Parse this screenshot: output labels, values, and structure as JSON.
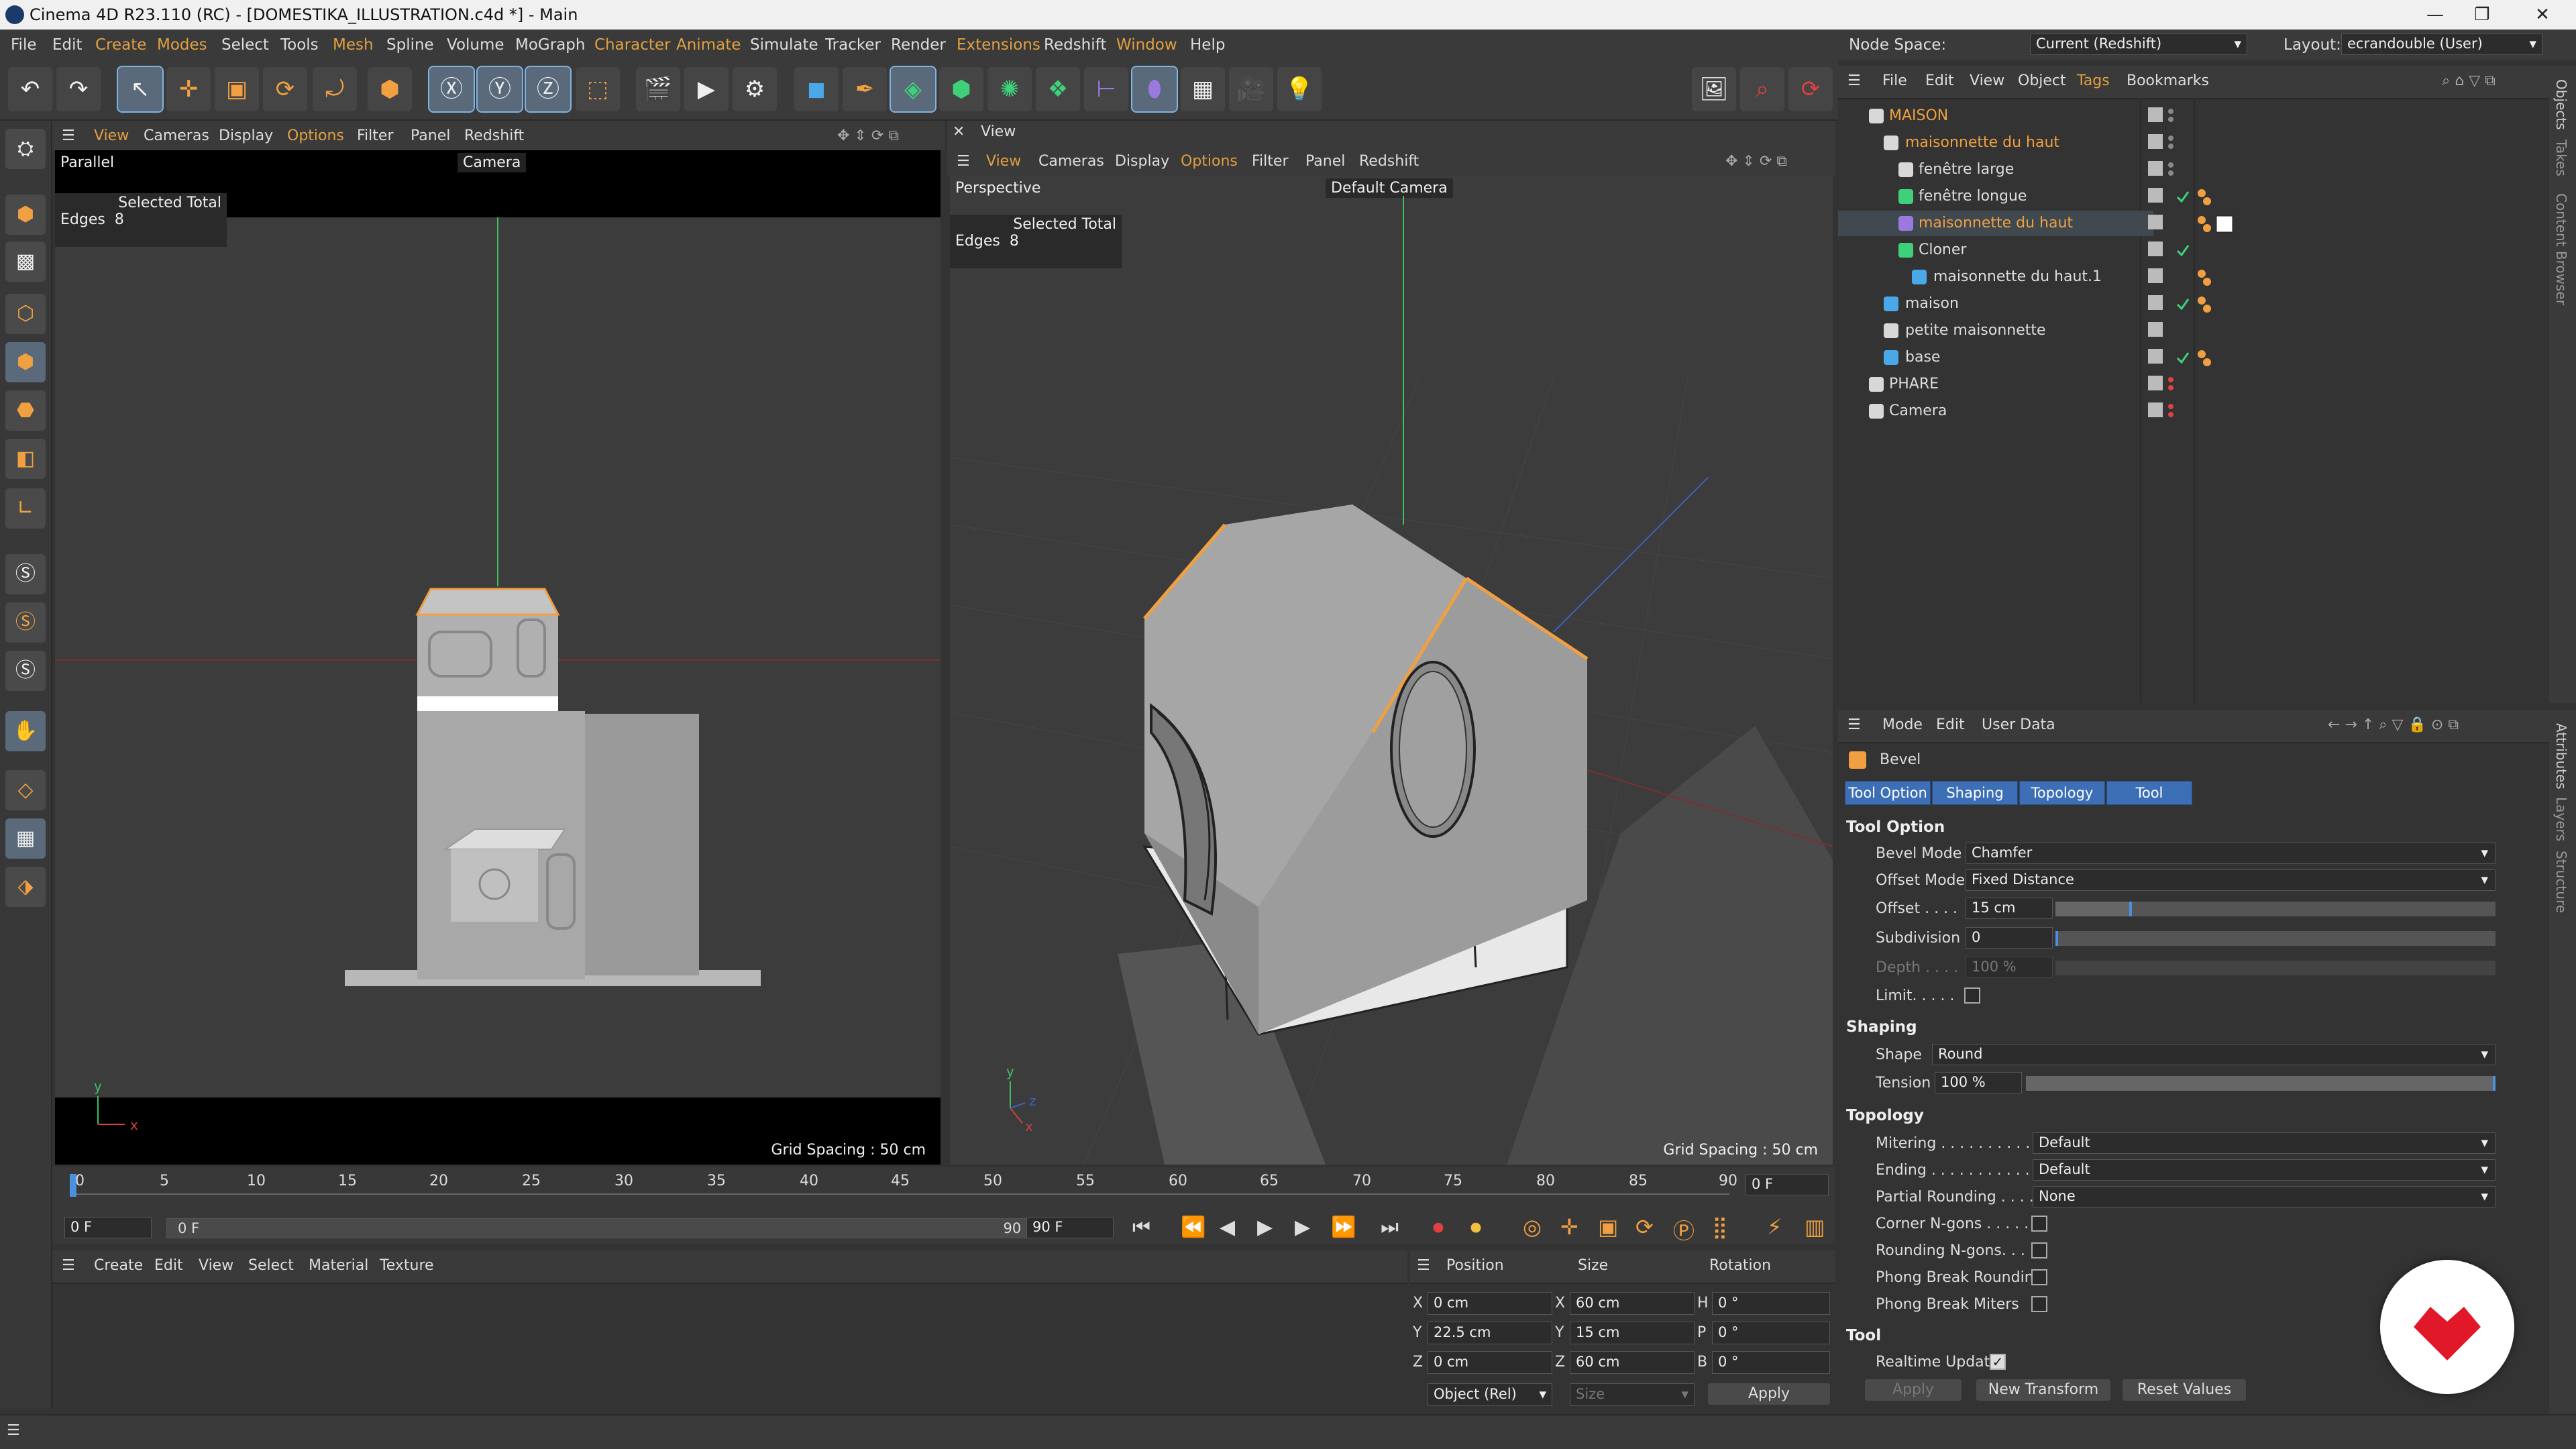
{
  "window": {
    "title": "Cinema 4D R23.110 (RC) - [DOMESTIKA_ILLUSTRATION.c4d *] - Main",
    "min": "—",
    "max": "❐",
    "close": "✕"
  },
  "menubar": {
    "items": [
      "File",
      "Edit",
      "Create",
      "Modes",
      "Select",
      "Tools",
      "Mesh",
      "Spline",
      "Volume",
      "MoGraph",
      "Character",
      "Animate",
      "Simulate",
      "Tracker",
      "Render",
      "Extensions",
      "Redshift",
      "Window",
      "Help"
    ],
    "node_space_label": "Node Space:",
    "node_space_value": "Current (Redshift)",
    "layout_label": "Layout:",
    "layout_value": "ecrandouble (User)"
  },
  "left_viewport": {
    "menu": [
      "View",
      "Cameras",
      "Display",
      "Options",
      "Filter",
      "Panel",
      "Redshift"
    ],
    "projection": "Parallel",
    "camera": "Camera",
    "selected_total": "Selected Total",
    "edges_label": "Edges",
    "edges_value": "8",
    "grid_spacing": "Grid Spacing : 50 cm"
  },
  "right_viewport": {
    "tab": "View",
    "menu": [
      "View",
      "Cameras",
      "Display",
      "Options",
      "Filter",
      "Panel",
      "Redshift"
    ],
    "projection": "Perspective",
    "camera": "Default Camera",
    "selected_total": "Selected Total",
    "edges_label": "Edges",
    "edges_value": "8",
    "grid_spacing": "Grid Spacing : 50 cm"
  },
  "object_manager": {
    "menu": [
      "File",
      "Edit",
      "View",
      "Object",
      "Tags",
      "Bookmarks"
    ],
    "objects": [
      {
        "name": "MAISON",
        "orange": true
      },
      {
        "name": "maisonnette du haut",
        "orange": true
      },
      {
        "name": "fenêtre large",
        "orange": false
      },
      {
        "name": "fenêtre longue",
        "orange": false
      },
      {
        "name": "maisonnette du haut",
        "orange": true
      },
      {
        "name": "Cloner",
        "orange": false
      },
      {
        "name": "maisonnette du haut.1",
        "orange": false
      },
      {
        "name": "maison",
        "orange": false
      },
      {
        "name": "petite maisonnette",
        "orange": false
      },
      {
        "name": "base",
        "orange": false
      },
      {
        "name": "PHARE",
        "orange": false
      },
      {
        "name": "Camera",
        "orange": false
      }
    ],
    "side_tabs": [
      "Objects",
      "Takes",
      "Content Browser"
    ]
  },
  "attributes": {
    "menu": [
      "Mode",
      "Edit",
      "User Data"
    ],
    "tool_name": "Bevel",
    "tabs": [
      "Tool Option",
      "Shaping",
      "Topology",
      "Tool"
    ],
    "sections": {
      "tool_option": "Tool Option",
      "shaping": "Shaping",
      "topology": "Topology",
      "tool": "Tool"
    },
    "fields": {
      "bevel_mode_label": "Bevel Mode",
      "bevel_mode": "Chamfer",
      "offset_mode_label": "Offset Mode",
      "offset_mode": "Fixed Distance",
      "offset_label": "Offset . . . .",
      "offset": "15 cm",
      "subdivision_label": "Subdivision",
      "subdivision": "0",
      "depth_label": "Depth . . . .",
      "depth": "100 %",
      "limit_label": "Limit. . . . .",
      "shape_label": "Shape",
      "shape": "Round",
      "tension_label": "Tension",
      "tension": "100 %",
      "mitering_label": "Mitering . . . . . . . . . .",
      "mitering": "Default",
      "ending_label": "Ending . . . . . . . . . . .",
      "ending": "Default",
      "partial_rounding_label": "Partial Rounding . . . . . .",
      "partial_rounding": "None",
      "corner_ngons_label": "Corner N-gons . . . . . .",
      "rounding_ngons_label": "Rounding N-gons. . . . .",
      "phong_rounding_label": "Phong Break Rounding",
      "phong_miters_label": "Phong Break Miters",
      "realtime_label": "Realtime Update"
    },
    "buttons": {
      "apply": "Apply",
      "new_transform": "New Transform",
      "reset": "Reset Values"
    },
    "side_tabs": [
      "Attributes",
      "Layers",
      "Structure"
    ]
  },
  "timeline": {
    "ticks": [
      "0",
      "5",
      "10",
      "15",
      "20",
      "25",
      "30",
      "35",
      "40",
      "45",
      "50",
      "55",
      "60",
      "65",
      "70",
      "75",
      "80",
      "85",
      "90"
    ],
    "current_frame": "0 F",
    "start": "0 F",
    "range_start": "0 F",
    "range_end": "90 F",
    "end": "90 F"
  },
  "material_manager": {
    "menu": [
      "Create",
      "Edit",
      "View",
      "Select",
      "Material",
      "Texture"
    ]
  },
  "coordinates": {
    "headers": [
      "Position",
      "Size",
      "Rotation"
    ],
    "rows": [
      {
        "axis": "X",
        "pos": "0 cm",
        "size_axis": "X",
        "size": "60 cm",
        "rot_axis": "H",
        "rot": "0 °"
      },
      {
        "axis": "Y",
        "pos": "22.5 cm",
        "size_axis": "Y",
        "size": "15 cm",
        "rot_axis": "P",
        "rot": "0 °"
      },
      {
        "axis": "Z",
        "pos": "0 cm",
        "size_axis": "Z",
        "size": "60 cm",
        "rot_axis": "B",
        "rot": "0 °"
      }
    ],
    "mode": "Object (Rel)",
    "size_mode": "Size",
    "apply": "Apply"
  },
  "colors": {
    "accent_orange": "#f0a040",
    "selection_blue": "#3c6fb5",
    "brand_red": "#e0182a"
  }
}
